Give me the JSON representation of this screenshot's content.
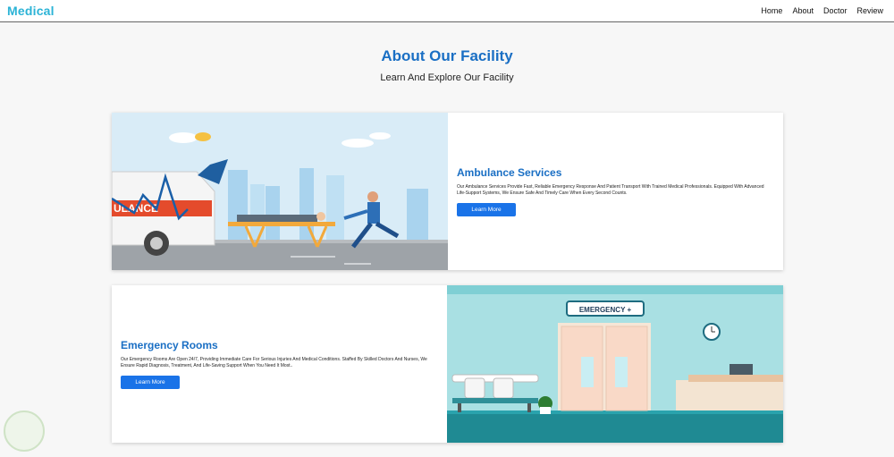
{
  "brand": {
    "name": "Medical"
  },
  "nav": {
    "items": [
      "Home",
      "About",
      "Doctor",
      "Review"
    ]
  },
  "section": {
    "title": "About Our Facility",
    "subtitle": "Learn And Explore Our Facility"
  },
  "cards": [
    {
      "title": "Ambulance Services",
      "description": "Our Ambulance Services Provide Fast, Reliable Emergency Response And Patient Transport With Trained Medical Professionals. Equipped With Advanced Life-Support Systems, We Ensure Safe And Timely Care When Every Second Counts.",
      "button": "Learn More",
      "image_text": "ULANCE"
    },
    {
      "title": "Emergency Rooms",
      "description": "Our Emergency Rooms Are Open 24/7, Providing Immediate Care For Serious Injuries And Medical Conditions. Staffed By Skilled Doctors And Nurses, We Ensure Rapid Diagnosis, Treatment, And Life-Saving Support When You Need It Most..",
      "button": "Learn More",
      "image_text": "EMERGENCY +"
    }
  ],
  "colors": {
    "accent": "#1a6fc4",
    "brand": "#2bb3d6",
    "button": "#1a73e8"
  }
}
